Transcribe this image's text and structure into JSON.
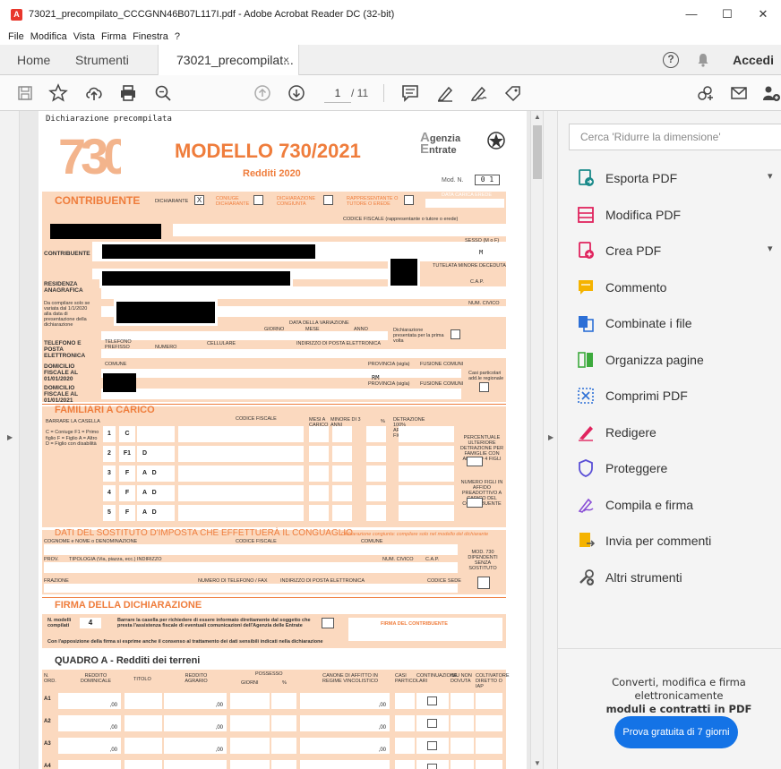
{
  "window": {
    "title": "73021_precompilato_CCCGNN46B07L117I.pdf - Adobe Acrobat Reader DC (32-bit)",
    "controls": {
      "minimize": "—",
      "maximize": "☐",
      "close": "✕"
    }
  },
  "menu": [
    "File",
    "Modifica",
    "Vista",
    "Firma",
    "Finestra",
    "?"
  ],
  "tabs": {
    "home": "Home",
    "tools": "Strumenti",
    "document": "73021_precompilat...",
    "close": "×"
  },
  "header": {
    "help": "?",
    "login": "Accedi"
  },
  "toolbar": {
    "page_current": "1",
    "page_total": "/ 11"
  },
  "right_panel": {
    "search_placeholder": "Cerca 'Ridurre la dimensione'",
    "tools": [
      {
        "label": "Esporta PDF",
        "icon": "export-pdf-icon",
        "color": "#1a8a8a",
        "expandable": true
      },
      {
        "label": "Modifica PDF",
        "icon": "edit-pdf-icon",
        "color": "#e0245e",
        "expandable": false
      },
      {
        "label": "Crea PDF",
        "icon": "create-pdf-icon",
        "color": "#e0245e",
        "expandable": true
      },
      {
        "label": "Commento",
        "icon": "comment-icon",
        "color": "#f5b300",
        "expandable": false
      },
      {
        "label": "Combinate i file",
        "icon": "combine-files-icon",
        "color": "#2c6fd6",
        "expandable": false
      },
      {
        "label": "Organizza pagine",
        "icon": "organize-pages-icon",
        "color": "#3daa3d",
        "expandable": false
      },
      {
        "label": "Comprimi PDF",
        "icon": "compress-pdf-icon",
        "color": "#2c6fd6",
        "expandable": false
      },
      {
        "label": "Redigere",
        "icon": "redact-icon",
        "color": "#e0245e",
        "expandable": false
      },
      {
        "label": "Proteggere",
        "icon": "protect-icon",
        "color": "#5a4fd6",
        "expandable": false
      },
      {
        "label": "Compila e firma",
        "icon": "fill-sign-icon",
        "color": "#8a4fd6",
        "expandable": false
      },
      {
        "label": "Invia per commenti",
        "icon": "send-comments-icon",
        "color": "#f5b300",
        "expandable": false
      },
      {
        "label": "Altri strumenti",
        "icon": "more-tools-icon",
        "color": "#555555",
        "expandable": false
      }
    ],
    "promo_text_1": "Converti, modifica e firma elettronicamente",
    "promo_text_2": "moduli e contratti in PDF",
    "trial_button": "Prova gratuita di 7 giorni"
  },
  "pdf": {
    "top_label": "Dichiarazione precompilata",
    "logo": "730",
    "title": "MODELLO 730/2021",
    "subtitle": "Redditi 2020",
    "agency_1": "genzia",
    "agency_2": "ntrate",
    "mod_n_label": "Mod. N.",
    "mod_n_value": "0 1",
    "sections": {
      "contribuente": "CONTRIBUENTE",
      "familiari": "FAMILIARI A CARICO",
      "sostituto": "DATI DEL SOSTITUTO D'IMPOSTA CHE EFFETTUERÀ IL CONGUAGLIO",
      "firma": "FIRMA DELLA DICHIARAZIONE",
      "quadro_a": "QUADRO A - Redditi dei terreni"
    },
    "labels": {
      "dichiarante": "DICHIARANTE",
      "dichiarante_mark": "X",
      "coniuge": "CONIUGE DICHIARANTE",
      "dich_congiunta": "DICHIARAZIONE CONGIUNTA",
      "rappresentante": "RAPPRESENTANTE O TUTORE O EREDE",
      "data_carica": "DATA CARICA EREDE",
      "codice_fiscale_rapp": "CODICE FISCALE (rappresentante o tutore o erede)",
      "contribuente_row": "CONTRIBUENTE",
      "sesso": "SESSO (M o F)",
      "sesso_val": "M",
      "tutela": "TUTELATA MINORE DECEDUTA",
      "residenza": "RESIDENZA ANAGRAFICA",
      "da_compilare": "Da compilare solo se variata dal 1/1/2020 alla data di presentazione della dichiarazione",
      "cap": "C.A.P.",
      "num_civico": "NUM. CIVICO",
      "data_variazione": "DATA DELLA VARIAZIONE",
      "giorno": "GIORNO",
      "mese": "MESE",
      "anno": "ANNO",
      "prima_volta": "Dichiarazione presentata per la prima volta",
      "telefono": "TELEFONO E POSTA ELETTRONICA",
      "telefono_label": "TELEFONO PREFISSO",
      "numero": "NUMERO",
      "cellulare": "CELLULARE",
      "email": "INDIRIZZO DI POSTA ELETTRONICA",
      "dom_2020": "DOMICILIO FISCALE AL 01/01/2020",
      "dom_2021": "DOMICILIO FISCALE AL 01/01/2021",
      "comune": "COMUNE",
      "provincia": "PROVINCIA (sigla)",
      "fusione": "FUSIONE COMUNI",
      "prov_val": "RM",
      "casi": "Casi particolari add.le regionale",
      "barrare": "BARRARE LA CASELLA",
      "legend": "C = Coniuge  F1 = Primo figlio  F = Figlio  A = Altro  D = Figlio con disabilità",
      "cf_fam": "CODICE FISCALE",
      "mesi": "MESI A CARICO",
      "minore": "MINORE DI 3 ANNI",
      "perc": "%",
      "detrazione": "DETRAZIONE 100% AFFIDAMENTO FIGLI",
      "perc_ult": "PERCENTUALE ULTERIORE DETRAZIONE PER FAMIGLIE CON ALMENO 4 FIGLI",
      "num_figli": "NUMERO FIGLI IN AFFIDO PREADOTTIVO A CARICO DEL CONTRIBUENTE",
      "cognome_sost": "COGNOME e NOME o DENOMINAZIONE",
      "cf_sost": "CODICE FISCALE",
      "comune_sost": "COMUNE",
      "prov_sost": "PROV.",
      "tipologia": "TIPOLOGIA (Via, piazza, ecc.)",
      "indirizzo": "INDIRIZZO",
      "num_civ_sost": "NUM. CIVICO",
      "cap_sost": "C.A.P.",
      "frazione": "FRAZIONE",
      "num_tel_fax": "NUMERO DI TELEFONO / FAX",
      "email_sost": "INDIRIZZO DI POSTA ELETTRONICA",
      "codice_sede": "CODICE SEDE",
      "mod730": "MOD. 730 DIPENDENTI SENZA SOSTITUTO",
      "conjunta_note": "Dichiarazione congiunta: compilare solo nel modello del dichiarante",
      "n_modelli": "N. modelli compilati",
      "n_modelli_val": "4",
      "barrare_firma": "Barrare la casella per richiedere di essere informato direttamente dal soggetto che presta l'assistenza fiscale di eventuali comunicazioni dell'Agenzia delle Entrate",
      "firma_contribuente": "FIRMA DEL CONTRIBUENTE",
      "apposizione": "Con l'apposizione della firma si esprime anche il consenso al trattamento dei dati sensibili indicati nella dichiarazione",
      "n_ord": "N. ORD.",
      "reddito_dom": "REDDITO DOMINICALE",
      "titolo": "TITOLO",
      "reddito_agr": "REDDITO AGRARIO",
      "possesso": "POSSESSO",
      "giorni": "GIORNI",
      "canone": "CANONE DI AFFITTO IN REGIME VINCOLISTICO",
      "casi_part": "CASI PARTICOLARI",
      "continuazione": "CONTINUAZIONE",
      "imu": "IMU NON DOVUTA",
      "coltivatore": "COLTIVATORE DIRETTO O IAP",
      "zero": ",00"
    },
    "familiari_rows": [
      {
        "n": "1",
        "rel": "C",
        "fig": ""
      },
      {
        "n": "2",
        "rel": "F1",
        "fig": "D"
      },
      {
        "n": "3",
        "rel": "F",
        "fig": "A   D"
      },
      {
        "n": "4",
        "rel": "F",
        "fig": "A   D"
      },
      {
        "n": "5",
        "rel": "F",
        "fig": "A   D"
      }
    ],
    "quadro_rows": [
      "A1",
      "A2",
      "A3",
      "A4"
    ]
  }
}
